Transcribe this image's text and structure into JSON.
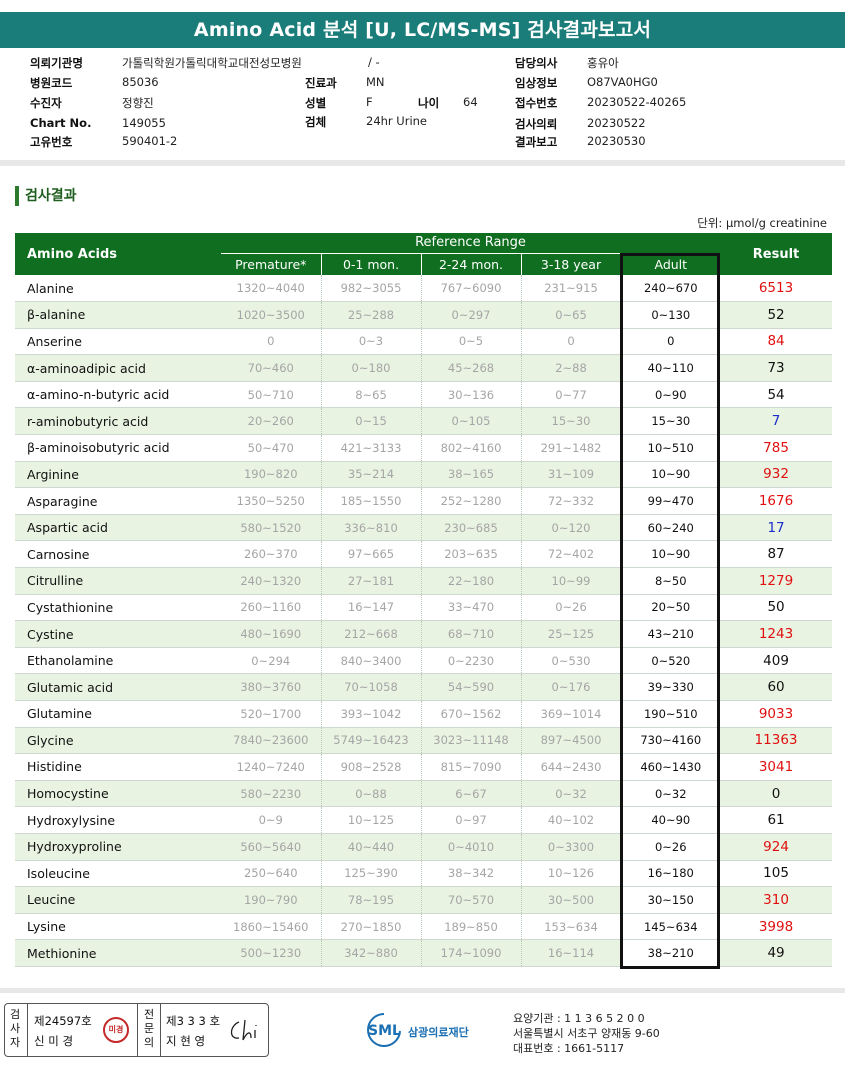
{
  "title": "Amino Acid 분석 [U, LC/MS-MS] 검사결과보고서",
  "info": {
    "institution": {
      "label": "의뢰기관명",
      "value": "가톨릭학원가톨릭대학교대전성모병원"
    },
    "ward": {
      "label": "병동",
      "value": "/ -"
    },
    "doctor": {
      "label": "담당의사",
      "value": "홍유아"
    },
    "hospital_code": {
      "label": "병원코드",
      "value": "85036"
    },
    "department": {
      "label": "진료과",
      "value": "MN"
    },
    "clinical_info": {
      "label": "임상정보",
      "value": "O87VA0HG0"
    },
    "patient": {
      "label": "수진자",
      "value": "정향진"
    },
    "sex": {
      "label": "성별",
      "value": "F"
    },
    "age": {
      "label": "나이",
      "value": "64"
    },
    "receipt_no": {
      "label": "접수번호",
      "value": "20230522-40265"
    },
    "chart_no": {
      "label": "Chart No.",
      "value": "149055"
    },
    "specimen": {
      "label": "검체",
      "value": "24hr Urine"
    },
    "test_request": {
      "label": "검사의뢰",
      "value": "20230522"
    },
    "unique_no": {
      "label": "고유번호",
      "value": "590401-2"
    },
    "result_report": {
      "label": "결과보고",
      "value": "20230530"
    }
  },
  "section_title": "검사결과",
  "unit": "단위: μmol/g creatinine",
  "table": {
    "col_amino": "Amino Acids",
    "col_reference": "Reference Range",
    "col_result": "Result",
    "sub_cols": [
      "Premature*",
      "0-1 mon.",
      "2-24 mon.",
      "3-18 year",
      "Adult"
    ],
    "rows": [
      {
        "name": "Alanine",
        "refs": [
          "1320~4040",
          "982~3055",
          "767~6090",
          "231~915"
        ],
        "adult": "240~670",
        "result": "6513",
        "flag": "high"
      },
      {
        "name": "β-alanine",
        "refs": [
          "1020~3500",
          "25~288",
          "0~297",
          "0~65"
        ],
        "adult": "0~130",
        "result": "52",
        "flag": "normal"
      },
      {
        "name": "Anserine",
        "refs": [
          "0",
          "0~3",
          "0~5",
          "0"
        ],
        "adult": "0",
        "result": "84",
        "flag": "high"
      },
      {
        "name": "α-aminoadipic acid",
        "refs": [
          "70~460",
          "0~180",
          "45~268",
          "2~88"
        ],
        "adult": "40~110",
        "result": "73",
        "flag": "normal"
      },
      {
        "name": "α-amino-n-butyric acid",
        "refs": [
          "50~710",
          "8~65",
          "30~136",
          "0~77"
        ],
        "adult": "0~90",
        "result": "54",
        "flag": "normal"
      },
      {
        "name": "r-aminobutyric acid",
        "refs": [
          "20~260",
          "0~15",
          "0~105",
          "15~30"
        ],
        "adult": "15~30",
        "result": "7",
        "flag": "low"
      },
      {
        "name": "β-aminoisobutyric acid",
        "refs": [
          "50~470",
          "421~3133",
          "802~4160",
          "291~1482"
        ],
        "adult": "10~510",
        "result": "785",
        "flag": "high"
      },
      {
        "name": "Arginine",
        "refs": [
          "190~820",
          "35~214",
          "38~165",
          "31~109"
        ],
        "adult": "10~90",
        "result": "932",
        "flag": "high"
      },
      {
        "name": "Asparagine",
        "refs": [
          "1350~5250",
          "185~1550",
          "252~1280",
          "72~332"
        ],
        "adult": "99~470",
        "result": "1676",
        "flag": "high"
      },
      {
        "name": "Aspartic acid",
        "refs": [
          "580~1520",
          "336~810",
          "230~685",
          "0~120"
        ],
        "adult": "60~240",
        "result": "17",
        "flag": "low"
      },
      {
        "name": "Carnosine",
        "refs": [
          "260~370",
          "97~665",
          "203~635",
          "72~402"
        ],
        "adult": "10~90",
        "result": "87",
        "flag": "normal"
      },
      {
        "name": "Citrulline",
        "refs": [
          "240~1320",
          "27~181",
          "22~180",
          "10~99"
        ],
        "adult": "8~50",
        "result": "1279",
        "flag": "high"
      },
      {
        "name": "Cystathionine",
        "refs": [
          "260~1160",
          "16~147",
          "33~470",
          "0~26"
        ],
        "adult": "20~50",
        "result": "50",
        "flag": "normal"
      },
      {
        "name": "Cystine",
        "refs": [
          "480~1690",
          "212~668",
          "68~710",
          "25~125"
        ],
        "adult": "43~210",
        "result": "1243",
        "flag": "high"
      },
      {
        "name": "Ethanolamine",
        "refs": [
          "0~294",
          "840~3400",
          "0~2230",
          "0~530"
        ],
        "adult": "0~520",
        "result": "409",
        "flag": "normal"
      },
      {
        "name": "Glutamic acid",
        "refs": [
          "380~3760",
          "70~1058",
          "54~590",
          "0~176"
        ],
        "adult": "39~330",
        "result": "60",
        "flag": "normal"
      },
      {
        "name": "Glutamine",
        "refs": [
          "520~1700",
          "393~1042",
          "670~1562",
          "369~1014"
        ],
        "adult": "190~510",
        "result": "9033",
        "flag": "high"
      },
      {
        "name": "Glycine",
        "refs": [
          "7840~23600",
          "5749~16423",
          "3023~11148",
          "897~4500"
        ],
        "adult": "730~4160",
        "result": "11363",
        "flag": "high"
      },
      {
        "name": "Histidine",
        "refs": [
          "1240~7240",
          "908~2528",
          "815~7090",
          "644~2430"
        ],
        "adult": "460~1430",
        "result": "3041",
        "flag": "high"
      },
      {
        "name": "Homocystine",
        "refs": [
          "580~2230",
          "0~88",
          "6~67",
          "0~32"
        ],
        "adult": "0~32",
        "result": "0",
        "flag": "normal"
      },
      {
        "name": "Hydroxylysine",
        "refs": [
          "0~9",
          "10~125",
          "0~97",
          "40~102"
        ],
        "adult": "40~90",
        "result": "61",
        "flag": "normal"
      },
      {
        "name": "Hydroxyproline",
        "refs": [
          "560~5640",
          "40~440",
          "0~4010",
          "0~3300"
        ],
        "adult": "0~26",
        "result": "924",
        "flag": "high"
      },
      {
        "name": "Isoleucine",
        "refs": [
          "250~640",
          "125~390",
          "38~342",
          "10~126"
        ],
        "adult": "16~180",
        "result": "105",
        "flag": "normal"
      },
      {
        "name": "Leucine",
        "refs": [
          "190~790",
          "78~195",
          "70~570",
          "30~500"
        ],
        "adult": "30~150",
        "result": "310",
        "flag": "high"
      },
      {
        "name": "Lysine",
        "refs": [
          "1860~15460",
          "270~1850",
          "189~850",
          "153~634"
        ],
        "adult": "145~634",
        "result": "3998",
        "flag": "high"
      },
      {
        "name": "Methionine",
        "refs": [
          "500~1230",
          "342~880",
          "174~1090",
          "16~114"
        ],
        "adult": "38~210",
        "result": "49",
        "flag": "normal"
      }
    ]
  },
  "footer": {
    "tester_vlabel": "검사자",
    "tester_id": "제24597호",
    "tester_name": "신 미 경",
    "stamp_text": "미경",
    "specialist_vlabel": "전문의",
    "specialist_id": "제3 3 3 호",
    "specialist_name": "지 현 영",
    "logo_text": "SML",
    "logo_name": "삼광의료재단",
    "lab_line1": "요양기관 : 1 1 3 6 5 2 0 0",
    "lab_line2": "서울특별시 서초구 양재동 9-60",
    "lab_line3": "대표번호 : 1661-5117"
  },
  "colors": {
    "header_teal": "#1b7d7a",
    "table_green": "#0f6e1f",
    "alt_row": "#e9f3e2",
    "high": "#e01010",
    "low": "#1a2ec8"
  }
}
